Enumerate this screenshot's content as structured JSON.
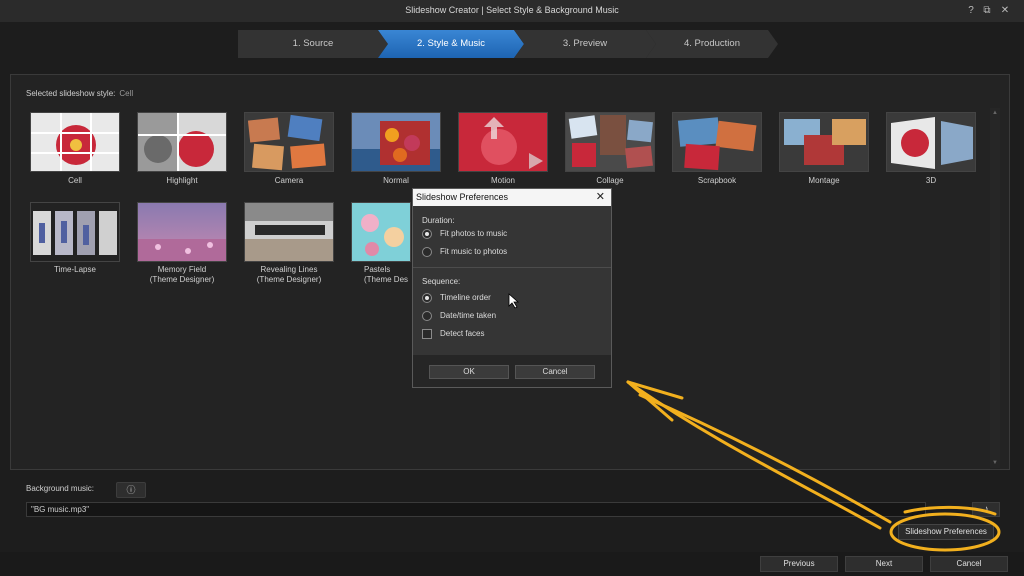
{
  "window": {
    "title": "Slideshow Creator | Select Style & Background Music",
    "help": "?",
    "restore": "⧉",
    "close": "✕"
  },
  "steps": [
    {
      "label": "1. Source"
    },
    {
      "label": "2. Style & Music"
    },
    {
      "label": "3. Preview"
    },
    {
      "label": "4. Production"
    }
  ],
  "style": {
    "selected_label": "Selected slideshow style:",
    "selected_value": "Cell",
    "items": [
      {
        "label": "Cell"
      },
      {
        "label": "Highlight"
      },
      {
        "label": "Camera"
      },
      {
        "label": "Normal"
      },
      {
        "label": "Motion"
      },
      {
        "label": "Collage"
      },
      {
        "label": "Scrapbook"
      },
      {
        "label": "Montage"
      },
      {
        "label": "3D"
      },
      {
        "label": "Time-Lapse"
      },
      {
        "label": "Memory Field",
        "sub": "(Theme Designer)"
      },
      {
        "label": "Revealing Lines",
        "sub": "(Theme Designer)"
      },
      {
        "label": "Pastels",
        "sub": "(Theme Des"
      }
    ]
  },
  "music": {
    "label": "Background music:",
    "info_icon": "ⓘ",
    "file": "\"BG music.mp3\"",
    "music_icon": "♪",
    "prefs_button": "Slideshow Preferences"
  },
  "footer": {
    "previous": "Previous",
    "next": "Next",
    "cancel": "Cancel"
  },
  "dialog": {
    "title": "Slideshow Preferences",
    "close": "✕",
    "duration_label": "Duration:",
    "duration_options": [
      "Fit photos to music",
      "Fit music to photos"
    ],
    "duration_selected": 0,
    "sequence_label": "Sequence:",
    "sequence_options": [
      "Timeline order",
      "Date/time taken"
    ],
    "sequence_selected": 0,
    "detect_faces": "Detect faces",
    "detect_faces_checked": false,
    "ok": "OK",
    "cancel": "Cancel"
  },
  "colors": {
    "accent": "#2a78c8",
    "annotation": "#f2b01e",
    "flower": "#c8283a"
  }
}
